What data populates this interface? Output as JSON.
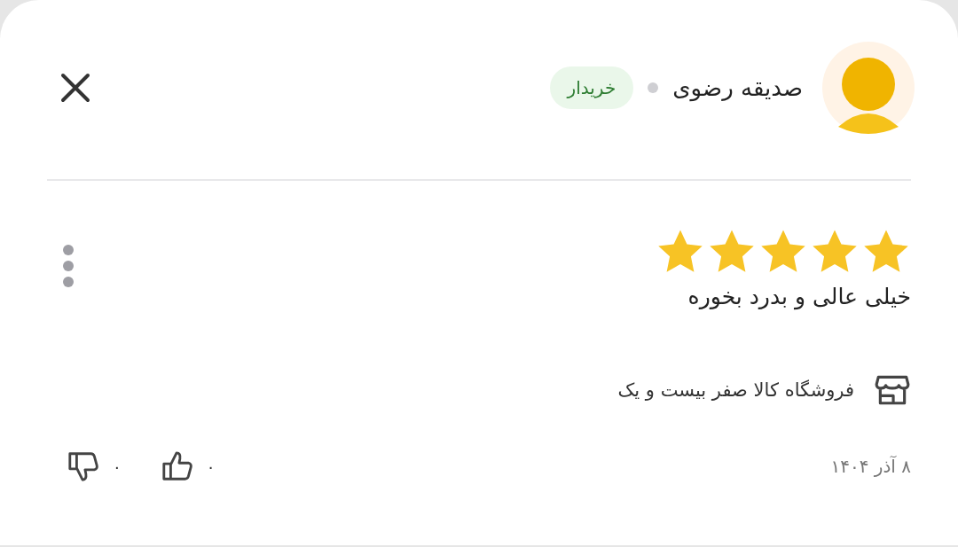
{
  "reviewer": {
    "name": "صدیقه رضوی",
    "badge": "خریدار"
  },
  "review": {
    "stars": 5,
    "text": "خیلی عالی و بدرد بخوره"
  },
  "seller": {
    "name": "فروشگاه کالا صفر بیست و یک"
  },
  "date": "۸ آذر ۱۴۰۴",
  "likes": "۰",
  "dislikes": "۰"
}
